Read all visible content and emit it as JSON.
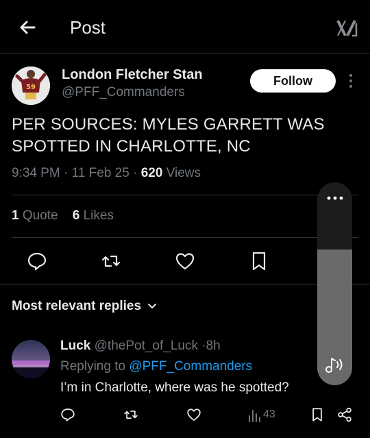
{
  "header": {
    "title": "Post"
  },
  "post": {
    "display_name": "London Fletcher Stan",
    "handle": "@PFF_Commanders",
    "follow_label": "Follow",
    "text_line1": "PER SOURCES: MYLES GARRETT WAS",
    "text_line2": "SPOTTED IN CHARLOTTE, NC",
    "time": "9:34 PM",
    "date": "11 Feb 25",
    "views_count": "620",
    "views_label": "Views",
    "quotes_count": "1",
    "quotes_label": "Quote",
    "likes_count": "6",
    "likes_label": "Likes",
    "avatar_jersey": "59"
  },
  "replies_section": {
    "sort_label": "Most relevant replies"
  },
  "reply": {
    "name": "Luck",
    "handle": "@thePot_of_Luck",
    "age": "8h",
    "replying_prefix": "Replying to",
    "mention": "@PFF_Commanders",
    "text": "I’m in Charlotte, where was he spotted?",
    "views": "43"
  },
  "media_control": {
    "level": 0.67
  },
  "icons": {
    "back": "arrow-left-icon",
    "logo": "x-logo-icon",
    "more": "more-vertical-icon",
    "reply": "reply-icon",
    "repost": "repost-icon",
    "like": "heart-icon",
    "bookmark": "bookmark-icon",
    "chevron": "chevron-down-icon",
    "views": "views-icon",
    "share": "share-icon",
    "music": "music-note-icon"
  },
  "colors": {
    "background": "#000000",
    "text": "#e7e9ea",
    "muted": "#71767b",
    "link": "#1d9bf0",
    "divider": "#2f3336"
  }
}
